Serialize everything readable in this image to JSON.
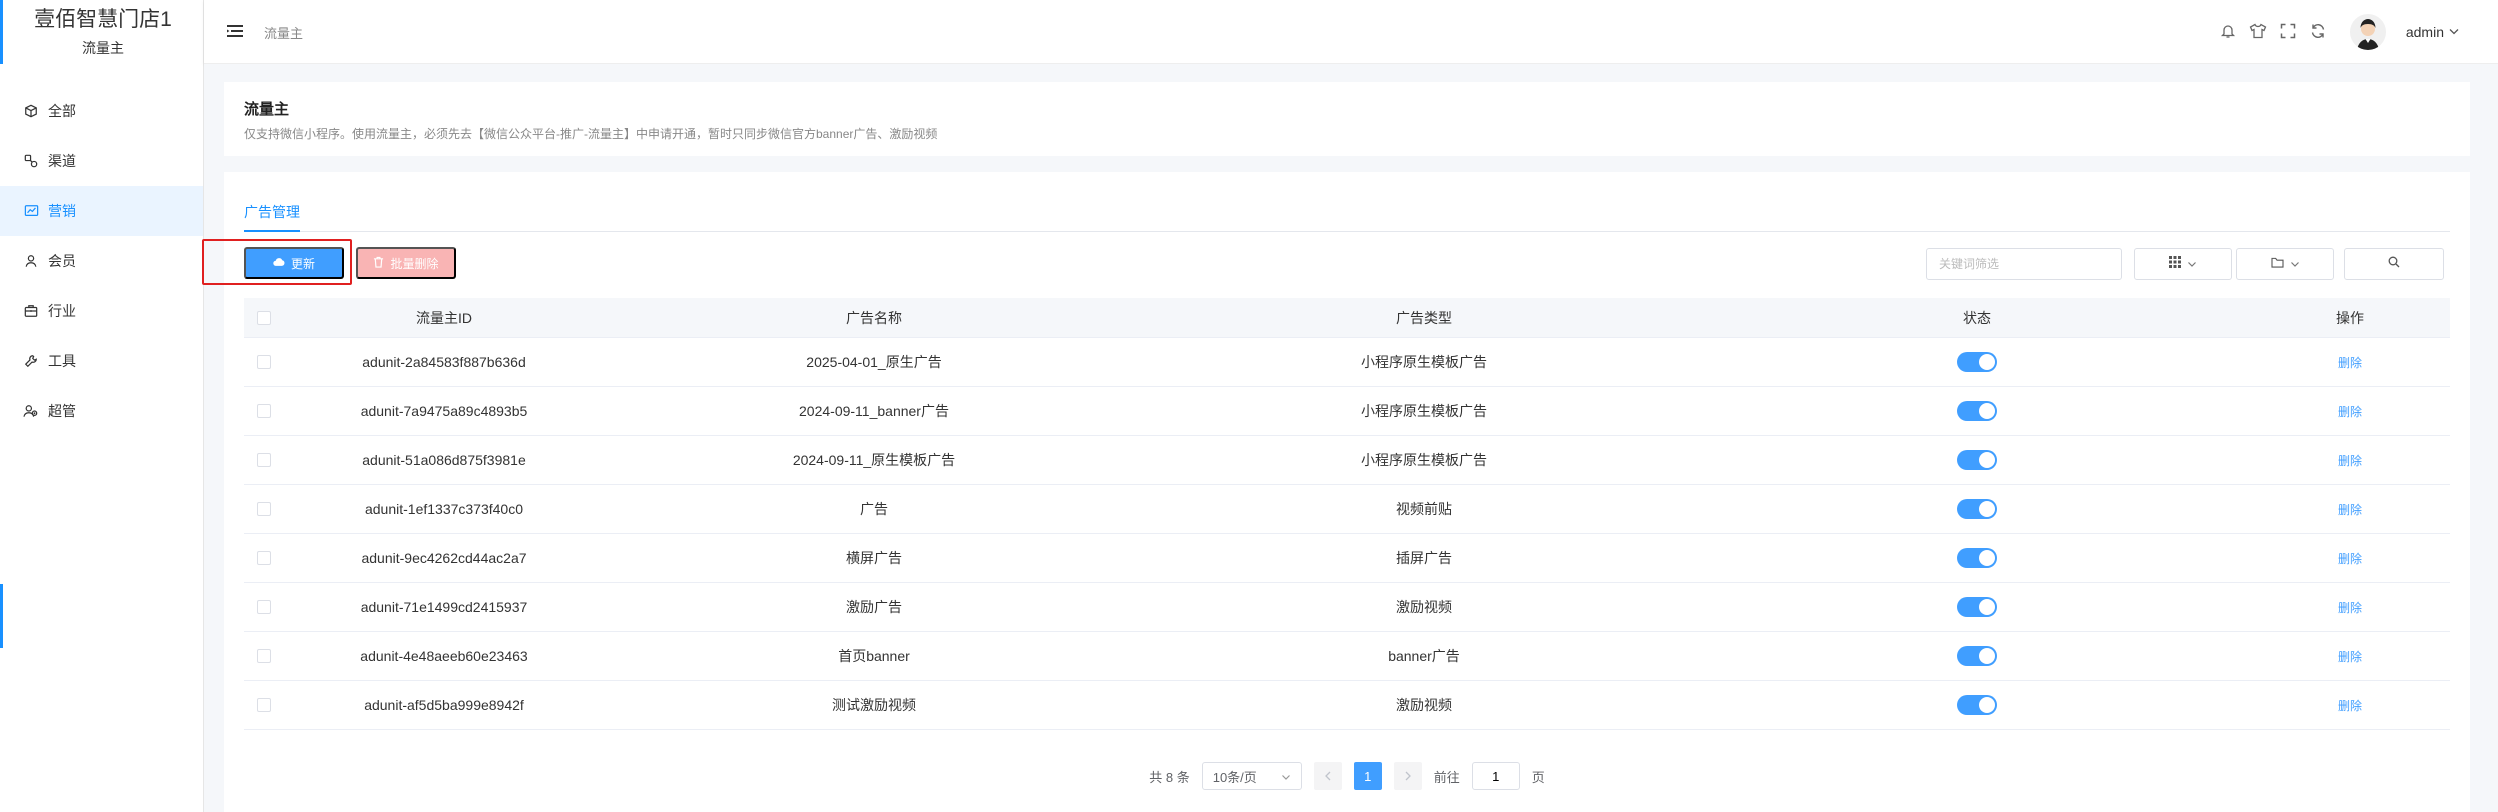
{
  "brand": {
    "title": "壹佰智慧门店1",
    "subtitle": "流量主"
  },
  "sidebar": {
    "items": [
      {
        "label": "全部",
        "icon": "cube-icon"
      },
      {
        "label": "渠道",
        "icon": "channel-icon"
      },
      {
        "label": "营销",
        "icon": "chart-icon",
        "active": true
      },
      {
        "label": "会员",
        "icon": "user-icon"
      },
      {
        "label": "行业",
        "icon": "briefcase-icon"
      },
      {
        "label": "工具",
        "icon": "wrench-icon"
      },
      {
        "label": "超管",
        "icon": "users-icon"
      }
    ]
  },
  "header": {
    "breadcrumb": "流量主",
    "icons": [
      "bell-icon",
      "shirt-icon",
      "fullscreen-icon",
      "refresh-icon"
    ],
    "user": "admin"
  },
  "intro": {
    "title": "流量主",
    "desc": "仅支持微信小程序。使用流量主，必须先去【微信公众平台-推广-流量主】中申请开通，暂时只同步微信官方banner广告、激励视频"
  },
  "tabs": {
    "active": "广告管理"
  },
  "toolbar": {
    "update_label": "更新",
    "bulk_delete_label": "批量删除",
    "search_placeholder": "关键词筛选"
  },
  "table": {
    "headers": {
      "id": "流量主ID",
      "name": "广告名称",
      "type": "广告类型",
      "status": "状态",
      "ops": "操作"
    },
    "delete_label": "删除",
    "rows": [
      {
        "id": "adunit-2a84583f887b636d",
        "name": "2025-04-01_原生广告",
        "type": "小程序原生模板广告",
        "enabled": true
      },
      {
        "id": "adunit-7a9475a89c4893b5",
        "name": "2024-09-11_banner广告",
        "type": "小程序原生模板广告",
        "enabled": true
      },
      {
        "id": "adunit-51a086d875f3981e",
        "name": "2024-09-11_原生模板广告",
        "type": "小程序原生模板广告",
        "enabled": true
      },
      {
        "id": "adunit-1ef1337c373f40c0",
        "name": "广告",
        "type": "视频前贴",
        "enabled": true
      },
      {
        "id": "adunit-9ec4262cd44ac2a7",
        "name": "横屏广告",
        "type": "插屏广告",
        "enabled": true
      },
      {
        "id": "adunit-71e1499cd2415937",
        "name": "激励广告",
        "type": "激励视频",
        "enabled": true
      },
      {
        "id": "adunit-4e48aeeb60e23463",
        "name": "首页banner",
        "type": "banner广告",
        "enabled": true
      },
      {
        "id": "adunit-af5d5ba999e8942f",
        "name": "测试激励视频",
        "type": "激励视频",
        "enabled": true
      }
    ]
  },
  "pagination": {
    "total_text": "共 8 条",
    "page_size": "10条/页",
    "current_page": "1",
    "goto_prefix": "前往",
    "goto_value": "1",
    "goto_suffix": "页"
  },
  "colors": {
    "primary": "#409eff",
    "danger_light": "#f9b4b4",
    "highlight": "#e02020"
  }
}
